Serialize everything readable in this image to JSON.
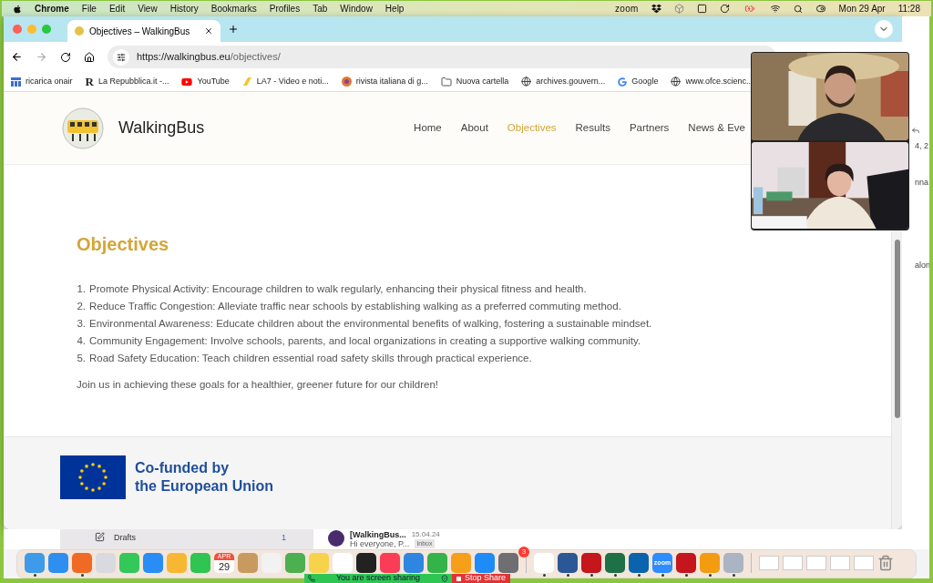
{
  "menubar": {
    "app": "Chrome",
    "menus": [
      "File",
      "Edit",
      "View",
      "History",
      "Bookmarks",
      "Profiles",
      "Tab",
      "Window",
      "Help"
    ],
    "zoom": "zoom",
    "date": "Mon 29 Apr",
    "time": "11:28"
  },
  "browser": {
    "tab": {
      "title": "Objectives – WalkingBus",
      "selected": true
    },
    "url": {
      "host": "https://walkingbus.eu",
      "path": "/objectives/"
    },
    "forward_disabled": true,
    "bookmarks": [
      {
        "kind": "bars",
        "label": "ricarica onair"
      },
      {
        "kind": "letter",
        "logo": "R",
        "label": "La Repubblica.it -..."
      },
      {
        "kind": "youtube",
        "label": "YouTube"
      },
      {
        "kind": "la7",
        "label": "LA7 - Video e noti..."
      },
      {
        "kind": "circle",
        "label": "rivista italiana di g..."
      },
      {
        "kind": "folder",
        "label": "Nuova cartella"
      },
      {
        "kind": "globe",
        "label": "archives.gouvern..."
      },
      {
        "kind": "google",
        "label": "Google"
      },
      {
        "kind": "globe",
        "label": "www.ofce.scienc..."
      }
    ]
  },
  "site": {
    "name": "WalkingBus",
    "nav": [
      {
        "label": "Home",
        "selected": false
      },
      {
        "label": "About",
        "selected": false
      },
      {
        "label": "Objectives",
        "selected": true
      },
      {
        "label": "Results",
        "selected": false
      },
      {
        "label": "Partners",
        "selected": false
      },
      {
        "label": "News & Eve",
        "selected": false
      }
    ],
    "heading": "Objectives",
    "objectives": [
      {
        "number": "1.",
        "text": "Promote Physical Activity: Encourage children to walk regularly, enhancing their physical fitness and health."
      },
      {
        "number": "2.",
        "text": "Reduce Traffic Congestion: Alleviate traffic near schools by establishing walking as a preferred commuting method."
      },
      {
        "number": "3.",
        "text": "Environmental Awareness: Educate children about the environmental benefits of walking, fostering a sustainable mindset."
      },
      {
        "number": "4.",
        "text": "Community Engagement: Involve schools, parents, and local organizations in creating a supportive walking community."
      },
      {
        "number": "5.",
        "text": "Road Safety Education: Teach children essential road safety skills through practical experience."
      }
    ],
    "closing": "Join us in achieving these goals for a healthier, greener future for our children!",
    "funding": [
      "Co-funded by",
      "the European Union"
    ]
  },
  "mail": {
    "side_snippets": [
      "4, 2",
      "nna",
      "alon"
    ],
    "folder": "Drafts",
    "folder_count": "1",
    "message": {
      "subject": "[WalkingBus...",
      "date": "15.04.24",
      "preview": "Hi everyone, P...",
      "tag": "Inbox"
    }
  },
  "dock": {
    "apps": [
      {
        "kind": "app",
        "running": true
      },
      {
        "kind": "app",
        "running": false
      },
      {
        "kind": "app",
        "running": true
      },
      {
        "kind": "app",
        "running": false
      },
      {
        "kind": "app",
        "running": false
      },
      {
        "kind": "app",
        "running": false
      },
      {
        "kind": "app",
        "running": false
      },
      {
        "kind": "app",
        "running": false
      },
      {
        "kind": "calendar",
        "running": false,
        "month": "APR",
        "day": "29"
      },
      {
        "kind": "app",
        "running": false
      },
      {
        "kind": "app",
        "running": false
      },
      {
        "kind": "app",
        "running": false
      },
      {
        "kind": "app"
      },
      {
        "kind": "app"
      },
      {
        "kind": "app"
      },
      {
        "kind": "app"
      },
      {
        "kind": "app"
      },
      {
        "kind": "app"
      },
      {
        "kind": "app"
      },
      {
        "kind": "app"
      },
      {
        "kind": "badged",
        "badge": "3"
      },
      {
        "kind": "app",
        "running": true
      },
      {
        "kind": "app",
        "running": true
      },
      {
        "kind": "app",
        "running": true
      },
      {
        "kind": "app",
        "running": true
      },
      {
        "kind": "app",
        "running": true
      },
      {
        "kind": "labelled",
        "running": true,
        "label": "zoom"
      },
      {
        "kind": "app",
        "running": true
      },
      {
        "kind": "app",
        "running": true
      },
      {
        "kind": "app",
        "running": true
      }
    ]
  },
  "share_bar": {
    "status": "You are screen sharing",
    "stop": "Stop Share"
  }
}
